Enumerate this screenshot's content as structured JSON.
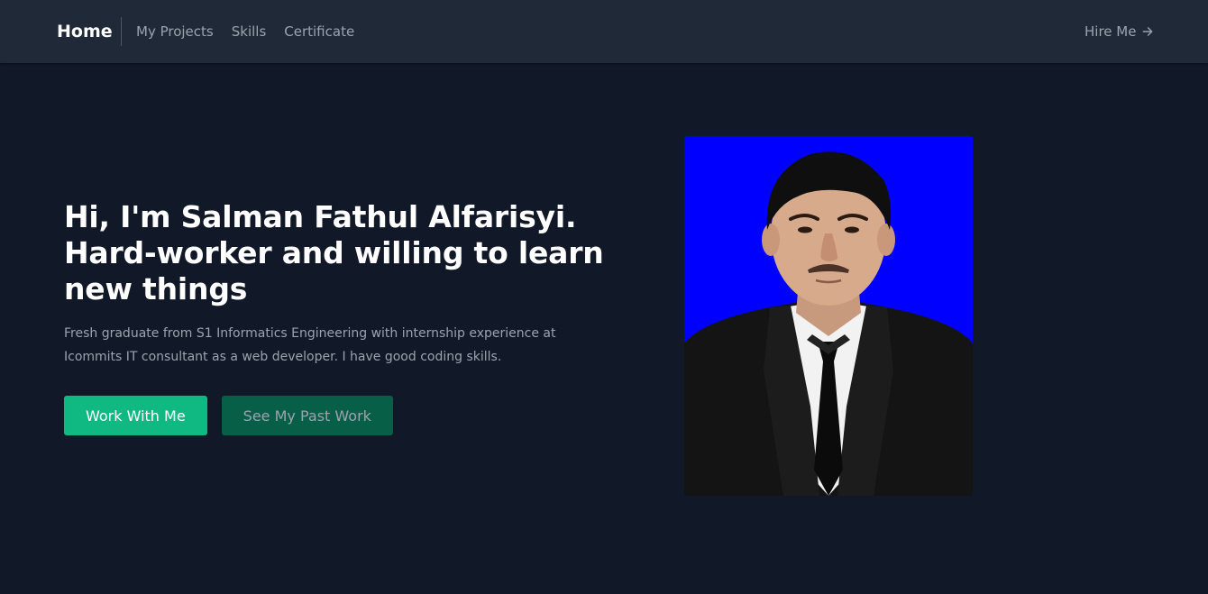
{
  "nav": {
    "brand": "Home",
    "links": [
      "My Projects",
      "Skills",
      "Certificate"
    ],
    "hire_label": "Hire Me"
  },
  "hero": {
    "headline_line1": "Hi, I'm Salman Fathul Alfarisyi.",
    "headline_line2": "Hard-worker and willing to learn",
    "headline_line3": "new things",
    "description": "Fresh graduate from S1 Informatics Engineering with internship experience at Icommits IT consultant as a web developer. I have good coding skills.",
    "primary_button": "Work With Me",
    "secondary_button": "See My Past Work"
  },
  "photo": {
    "background_color": "#0000ff"
  },
  "colors": {
    "page_bg": "#111827",
    "nav_bg": "#1f2937",
    "accent": "#10b981",
    "accent_dark": "#065f46",
    "muted_text": "#9ca3af"
  },
  "icons": {
    "hire": "arrow-right-icon"
  }
}
